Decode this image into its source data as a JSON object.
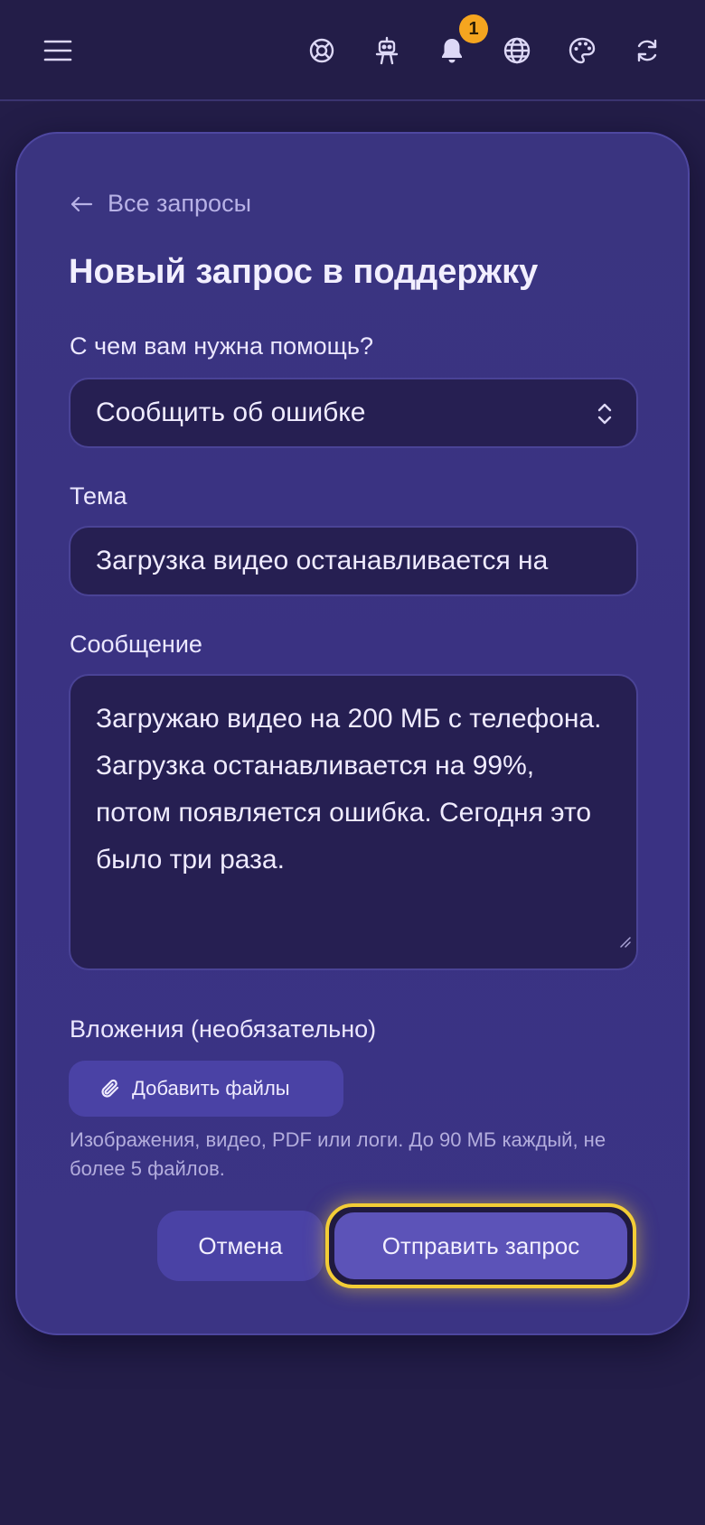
{
  "header": {
    "notification_count": "1",
    "icons": [
      "menu-icon",
      "lifebuoy-icon",
      "robot-icon",
      "bell-icon",
      "globe-icon",
      "palette-icon",
      "refresh-icon"
    ]
  },
  "form": {
    "back_label": "Все запросы",
    "title": "Новый запрос в поддержку",
    "help_label": "С чем вам нужна помощь?",
    "help_selected": "Сообщить об ошибке",
    "subject_label": "Тема",
    "subject_value": "Загрузка видео останавливается на",
    "message_label": "Сообщение",
    "message_value": "Загружаю видео на 200 МБ с телефона. Загрузка останавливается на 99%, потом появляется ошибка. Сегодня это было три раза.",
    "attachments_label": "Вложения (необязательно)",
    "attach_button": "Добавить файлы",
    "attach_hint": "Изображения, видео, PDF или логи. До 90 МБ каждый, не более 5 файлов.",
    "cancel_button": "Отмена",
    "submit_button": "Отправить запрос"
  },
  "colors": {
    "background": "#231d48",
    "card": "#3a3480",
    "badge": "#f5a51f",
    "focus_ring": "#f3cd36"
  }
}
